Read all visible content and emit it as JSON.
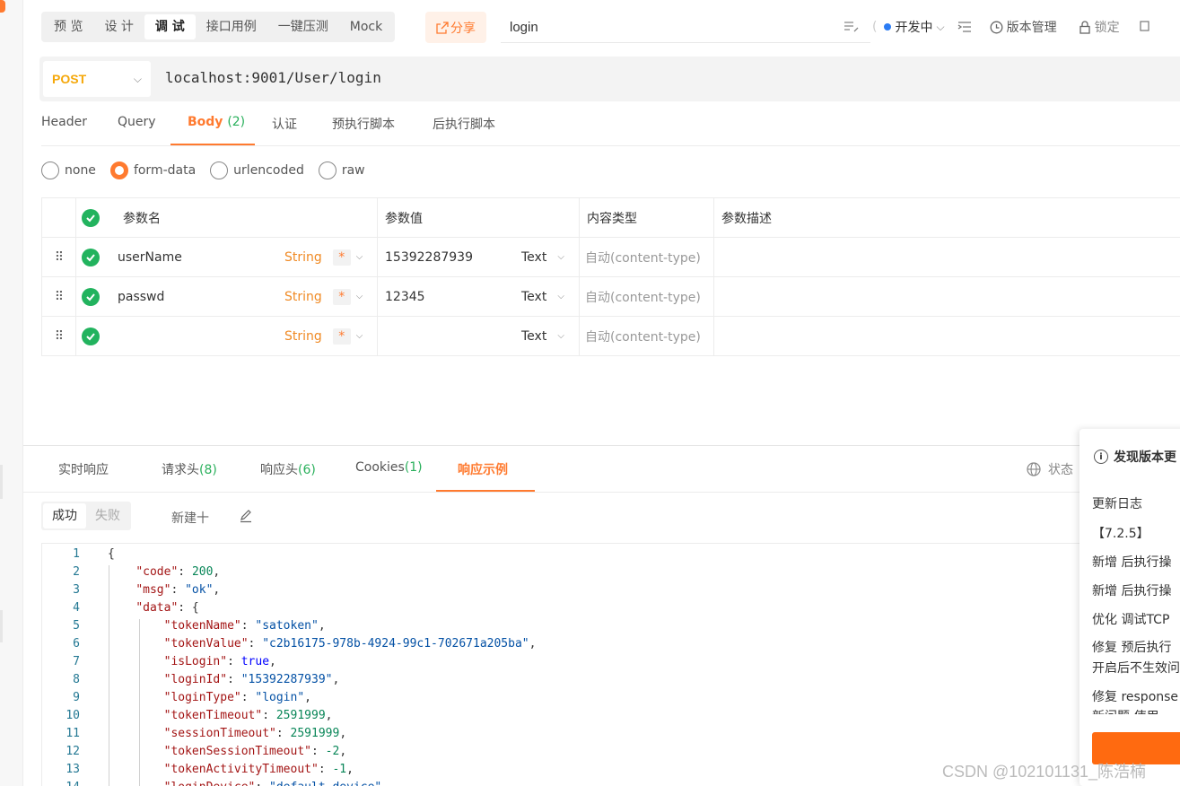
{
  "top_tabs": [
    "预 览",
    "设 计",
    "调 试",
    "接口用例",
    "一键压测",
    "Mock"
  ],
  "share_label": "分享",
  "api_name": "login",
  "status": "开发中",
  "version_label": "版本管理",
  "lock_label": "锁定",
  "request": {
    "method": "POST",
    "url": "localhost:9001/User/login"
  },
  "req_tabs": {
    "header": "Header",
    "query": "Query",
    "body": "Body",
    "body_count": "(2)",
    "auth": "认证",
    "pre_script": "预执行脚本",
    "post_script": "后执行脚本"
  },
  "body_types": [
    "none",
    "form-data",
    "urlencoded",
    "raw"
  ],
  "params_table": {
    "headers": [
      "参数名",
      "参数值",
      "内容类型",
      "参数描述"
    ],
    "rows": [
      {
        "name": "userName",
        "type": "String",
        "required": "*",
        "value": "15392287939",
        "value_type": "Text",
        "content_type": "自动(content-type)"
      },
      {
        "name": "passwd",
        "type": "String",
        "required": "*",
        "value": "12345",
        "value_type": "Text",
        "content_type": "自动(content-type)"
      },
      {
        "name": "",
        "type": "String",
        "required": "*",
        "value": "",
        "value_type": "Text",
        "content_type": "自动(content-type)"
      }
    ]
  },
  "resp_tabs": {
    "realtime": "实时响应",
    "req_headers": "请求头",
    "req_headers_count": "(8)",
    "resp_headers": "响应头",
    "resp_headers_count": "(6)",
    "cookies": "Cookies",
    "cookies_count": "(1)",
    "example": "响应示例"
  },
  "status_label": "状态",
  "example_seg": [
    "成功",
    "失败"
  ],
  "new_label": "新建十",
  "code_lines": [
    "{",
    "    \"code\": 200,",
    "    \"msg\": \"ok\",",
    "    \"data\": {",
    "        \"tokenName\": \"satoken\",",
    "        \"tokenValue\": \"c2b16175-978b-4924-99c1-702671a205ba\",",
    "        \"isLogin\": true,",
    "        \"loginId\": \"15392287939\",",
    "        \"loginType\": \"login\",",
    "        \"tokenTimeout\": 2591999,",
    "        \"sessionTimeout\": 2591999,",
    "        \"tokenSessionTimeout\": -2,",
    "        \"tokenActivityTimeout\": -1,",
    "        \"loginDevice\": \"default-device\","
  ],
  "popup": {
    "title": "发现版本更",
    "log_label": "更新日志",
    "version": "【7.2.5】",
    "lines": [
      "新增 后执行操",
      "新增 后执行操",
      "优化 调试TCP",
      "修复 预后执行",
      "开启后不生效问",
      "修复 response",
      "新问题 使用"
    ]
  },
  "watermark": "CSDN @102101131_陈浩楠"
}
